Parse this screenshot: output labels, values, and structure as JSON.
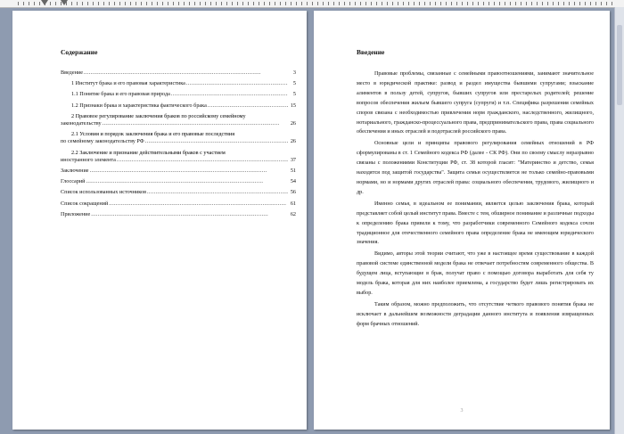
{
  "left_page": {
    "title": "Содержание",
    "toc": [
      {
        "text": "Введение",
        "page": "3",
        "indent": 0
      },
      {
        "text": "1 Институт брака и его правовая характеристика",
        "page": "5",
        "indent": 1
      },
      {
        "text": "1.1 Понятие брака и его правовая природа",
        "page": "5",
        "indent": 1
      },
      {
        "text": "1.2 Признаки брака и характеристика фактического брака",
        "page": "15",
        "indent": 1
      },
      {
        "text": "2 Правовое регулирование заключения браков по российскому семейному",
        "cont": "законодательству",
        "page": "26",
        "indent": 1
      },
      {
        "text": "2.1 Условия и порядок заключения брака и его правовые последствия",
        "cont": "по семейному законодательству РФ",
        "page": "26",
        "indent": 1
      },
      {
        "text": "2.2 Заключение и признание действительными браков с участием",
        "cont": "иностранного элемента",
        "page": "37",
        "indent": 1
      },
      {
        "text": "Заключение",
        "page": "51",
        "indent": 0
      },
      {
        "text": "Глоссарий",
        "page": "54",
        "indent": 0
      },
      {
        "text": "Список использованных источников",
        "page": "56",
        "indent": 0
      },
      {
        "text": "Список сокращений",
        "page": "61",
        "indent": 0
      },
      {
        "text": "Приложение",
        "page": "62",
        "indent": 0
      }
    ]
  },
  "right_page": {
    "title": "Введение",
    "paragraphs": [
      "Правовые проблемы, связанные с семейными правоотношениями, занимают значительное место в юридической практике: развод и раздел имущества бывшими супругами; взыскание алиментов в пользу детей, супругов, бывших супругов или престарелых родителей; решение вопросов обеспечения жильем бывшего супруга (супруги) и т.п. Специфика разрешения семейных споров связана с необходимостью привлечения норм гражданского, наследственного, жилищного, нотариального, гражданско-процессуального права, предпринимательского права, права социального обеспечения и иных отраслей и подотраслей российского права.",
      "Основные цели и принципы правового регулирования семейных отношений в РФ сформулированы в ст. 1 Семейного кодекса РФ (далее - СК РФ). Они по своему смыслу неразрывно связаны с положениями Конституции РФ, ст. 38 которой гласит: \"Материнство и детство, семья находятся под защитой государства\". Защита семьи осуществляется не только семейно-правовыми нормами, но и нормами других отраслей права: социального обеспечения, трудового, жилищного и др.",
      "Именно семья, в идеальном ее понимании, является целью заключения брака, который представляет собой целый институт права. Вместе с тем, обширное понимание и различные подходы к определению брака привели к тому, что разработчики современного Семейного кодекса сочли традиционное для отечественного семейного права определение брака не имеющим юридического значения.",
      "Видимо, авторы этой теории считают, что уже в настоящее время существование в каждой правовой системе единственной модели брака не отвечает потребностям современного общества. В будущем лица, вступающие в брак, получат право с помощью договора выработать для себя ту модель брака, которая для них наиболее приемлема, а государство будет лишь регистрировать их выбор.",
      "Таким образом, можно предположить, что отсутствие четкого правового понятия брака не исключает в дальнейшем возможности деградации данного института и появления извращенных форм брачных отношений."
    ],
    "page_number": "3"
  }
}
